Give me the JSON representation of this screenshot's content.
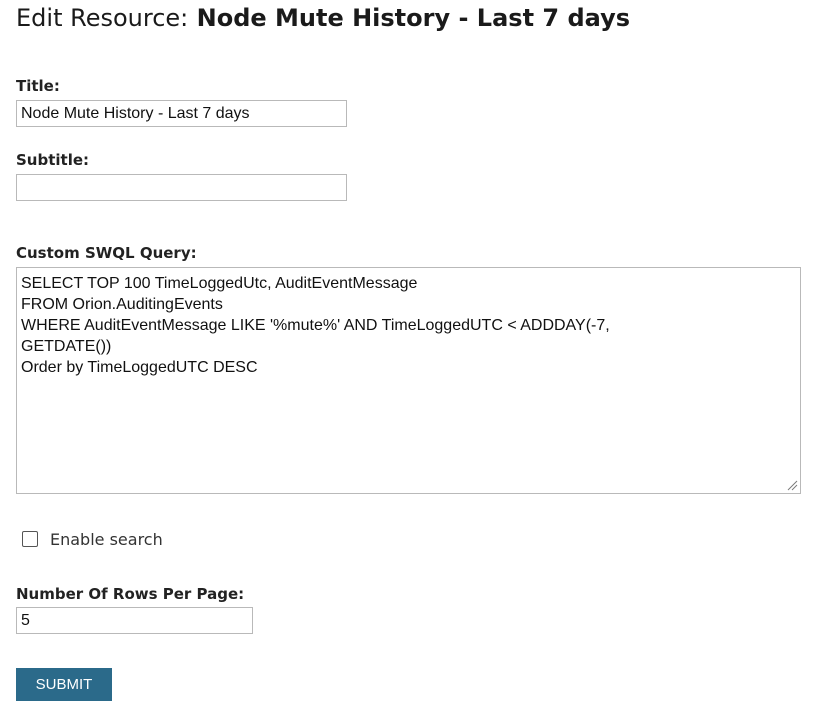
{
  "header": {
    "title_prefix": "Edit Resource:",
    "title_name": "Node Mute History - Last 7 days"
  },
  "form": {
    "title": {
      "label": "Title:",
      "value": "Node Mute History - Last 7 days"
    },
    "subtitle": {
      "label": "Subtitle:",
      "value": ""
    },
    "query": {
      "label": "Custom SWQL Query:",
      "value": "SELECT TOP 100 TimeLoggedUtc, AuditEventMessage\nFROM Orion.AuditingEvents\nWHERE AuditEventMessage LIKE '%mute%' AND TimeLoggedUTC < ADDDAY(-7,\nGETDATE())\nOrder by TimeLoggedUTC DESC"
    },
    "enable_search": {
      "label": "Enable search",
      "checked": false
    },
    "rows_per_page": {
      "label": "Number Of Rows Per Page:",
      "value": "5"
    },
    "submit_label": "SUBMIT"
  },
  "colors": {
    "submit_bg": "#2b6a8a",
    "input_border": "#b9b9b9"
  },
  "icons": {
    "resize_grip": "resize-grip-icon",
    "checkbox": "checkbox-unchecked"
  }
}
